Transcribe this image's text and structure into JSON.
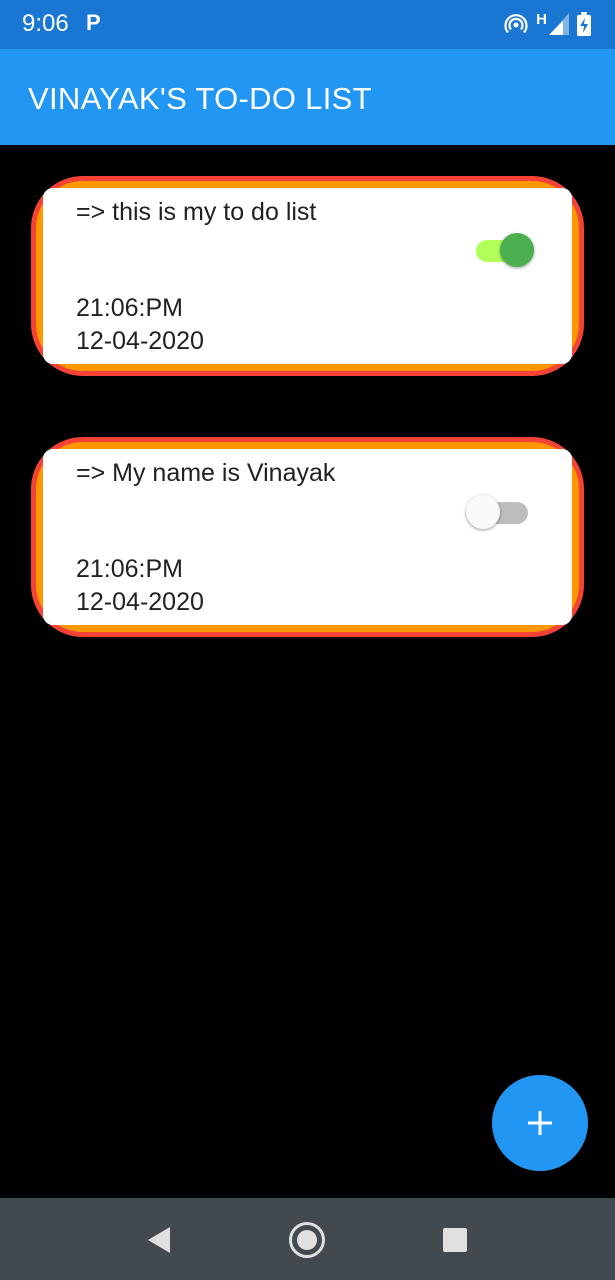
{
  "status_bar": {
    "time": "9:06",
    "app_icon": "P",
    "network_type": "H",
    "icons": [
      "hotspot-icon",
      "signal-icon",
      "battery-charging-icon"
    ]
  },
  "app_bar": {
    "title": "VINAYAK'S TO-DO LIST"
  },
  "todos": [
    {
      "text": "=> this is my to do list",
      "time": "21:06:PM",
      "date": "12-04-2020",
      "done": true
    },
    {
      "text": "=> My name is Vinayak",
      "time": "21:06:PM",
      "date": "12-04-2020",
      "done": false
    }
  ],
  "fab": {
    "icon": "plus-icon"
  },
  "navigation": {
    "icons": [
      "back-icon",
      "home-icon",
      "recents-icon"
    ]
  },
  "colors": {
    "status_bar": "#1976D2",
    "app_bar": "#2196F3",
    "background": "#000000",
    "card_border": "#F44336",
    "card_fill": "#FF9800",
    "switch_on": "#4CAF50",
    "fab": "#2196F3",
    "nav_bar": "#424A50"
  }
}
